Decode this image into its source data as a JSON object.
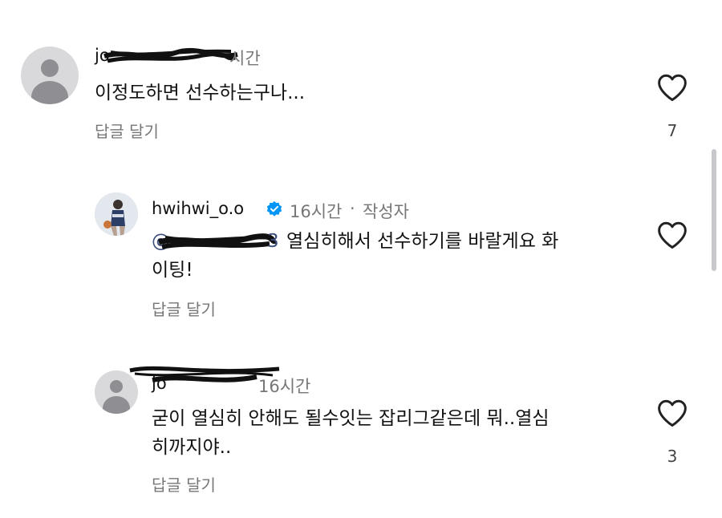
{
  "comments": [
    {
      "username": "jo",
      "time": "시간",
      "text": "이정도하면 선수하는구나...",
      "reply_label": "답글 달기",
      "likes": "7"
    },
    {
      "username": "hwihwi_o.o",
      "time": "16시간",
      "separator": "·",
      "author_badge": "작성자",
      "mention_prefix": "@",
      "mention_suffix": "3",
      "text_line1": "열심히해서 선수하기를 바랄게요 화",
      "text_line2": "이팅!",
      "reply_label": "답글 달기"
    },
    {
      "username": "jo",
      "time": "16시간",
      "text_line1": "굳이 열심히 안해도 될수잇는 잡리그같은데 뭐..열심",
      "text_line2": "히까지야..",
      "reply_label": "답글 달기",
      "likes": "3"
    }
  ],
  "icons": {
    "like": "heart-icon",
    "verified": "verified-badge-icon",
    "avatar": "default-avatar-icon"
  },
  "colors": {
    "verified": "#0095f6",
    "secondary_text": "#777777"
  }
}
